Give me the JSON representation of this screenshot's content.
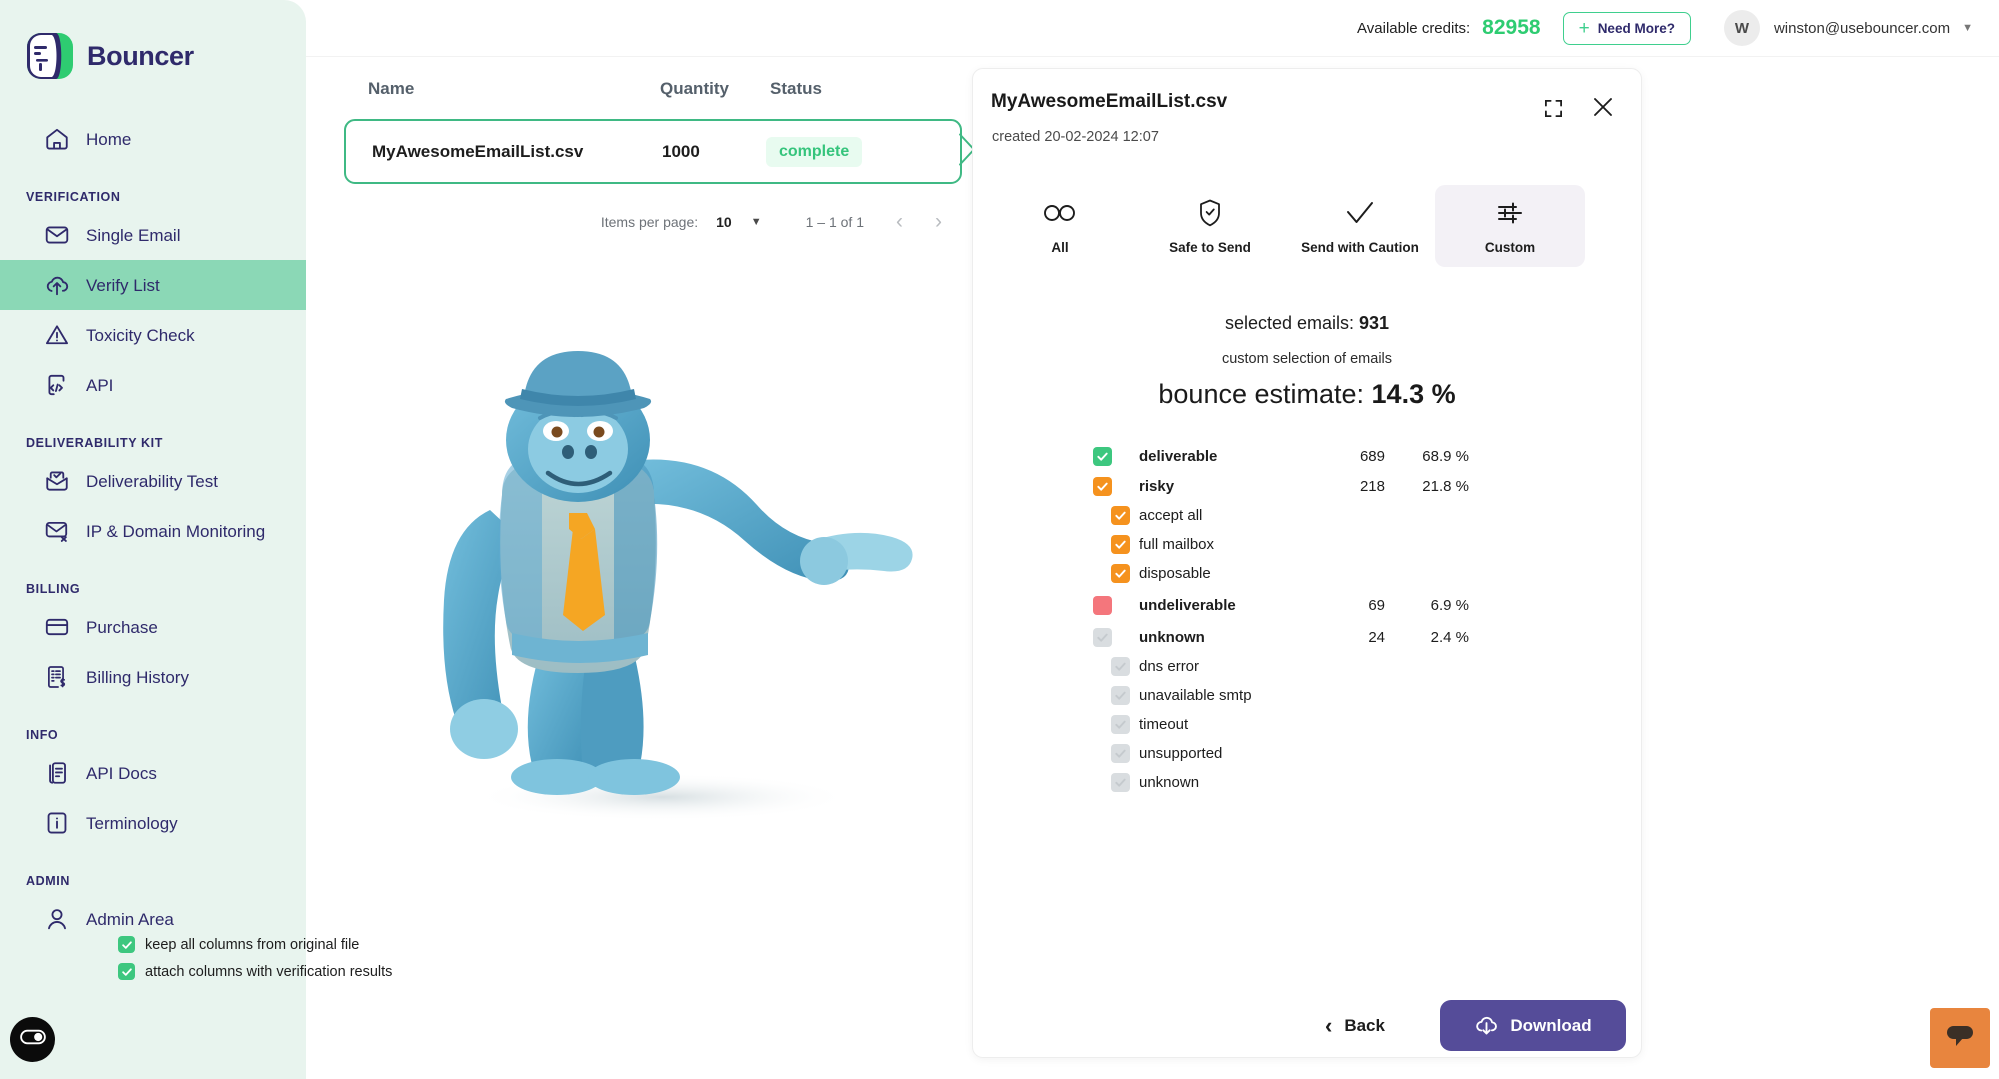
{
  "brand": {
    "name": "Bouncer"
  },
  "sidebar": {
    "home": {
      "label": "Home",
      "icon": "home-icon"
    },
    "sections": [
      {
        "title": "VERIFICATION",
        "items": [
          {
            "label": "Single Email",
            "icon": "envelope-icon",
            "active": false
          },
          {
            "label": "Verify List",
            "icon": "cloud-upload-icon",
            "active": true
          },
          {
            "label": "Toxicity Check",
            "icon": "warning-triangle-icon",
            "active": false
          },
          {
            "label": "API",
            "icon": "code-file-icon",
            "active": false
          }
        ]
      },
      {
        "title": "DELIVERABILITY KIT",
        "items": [
          {
            "label": "Deliverability Test",
            "icon": "envelope-check-icon",
            "active": false
          },
          {
            "label": "IP & Domain Monitoring",
            "icon": "envelope-x-icon",
            "active": false
          }
        ]
      },
      {
        "title": "BILLING",
        "items": [
          {
            "label": "Purchase",
            "icon": "credit-card-icon",
            "active": false
          },
          {
            "label": "Billing History",
            "icon": "invoice-dollar-icon",
            "active": false
          }
        ]
      },
      {
        "title": "INFO",
        "items": [
          {
            "label": "API Docs",
            "icon": "documents-icon",
            "active": false
          },
          {
            "label": "Terminology",
            "icon": "info-icon",
            "active": false
          }
        ]
      },
      {
        "title": "ADMIN",
        "items": [
          {
            "label": "Admin Area",
            "icon": "user-icon",
            "active": false
          }
        ]
      }
    ]
  },
  "topbar": {
    "credits_label": "Available credits:",
    "credits_value": "82958",
    "need_more_label": "Need More?",
    "need_more_plus": "+",
    "avatar_initial": "W",
    "user_email": "winston@usebouncer.com",
    "caret": "▼"
  },
  "table": {
    "columns": {
      "name": "Name",
      "quantity": "Quantity",
      "status": "Status"
    },
    "rows": [
      {
        "name": "MyAwesomeEmailList.csv",
        "quantity": "1000",
        "status": "complete"
      }
    ],
    "pager": {
      "items_per_page_label": "Items per page:",
      "items_per_page_value": "10",
      "caret": "▼",
      "range": "1 – 1 of 1",
      "prev": "‹",
      "next": "›"
    }
  },
  "panel": {
    "title": "MyAwesomeEmailList.csv",
    "created": "created 20-02-2024 12:07",
    "expand_icon": "expand-icon",
    "close_icon": "close-icon",
    "tabs": [
      {
        "label": "All",
        "icon": "infinity-icon",
        "selected": false
      },
      {
        "label": "Safe to Send",
        "icon": "shield-check-icon",
        "selected": false
      },
      {
        "label": "Send with Caution",
        "icon": "check-icon",
        "selected": false
      },
      {
        "label": "Custom",
        "icon": "sliders-icon",
        "selected": true
      }
    ],
    "selected_emails_label": "selected emails:",
    "selected_emails_value": "931",
    "subtitle": "custom selection of emails",
    "bounce_label": "bounce estimate:",
    "bounce_value": "14.3 %",
    "categories": [
      {
        "label": "deliverable",
        "count": "689",
        "pct": "68.9 %",
        "state": "green",
        "level": "major"
      },
      {
        "label": "risky",
        "count": "218",
        "pct": "21.8 %",
        "state": "orange",
        "level": "major"
      },
      {
        "label": "accept all",
        "count": "",
        "pct": "",
        "state": "orange",
        "level": "sub"
      },
      {
        "label": "full mailbox",
        "count": "",
        "pct": "",
        "state": "orange",
        "level": "sub"
      },
      {
        "label": "disposable",
        "count": "",
        "pct": "",
        "state": "orange",
        "level": "sub"
      },
      {
        "label": "undeliverable",
        "count": "69",
        "pct": "6.9 %",
        "state": "red",
        "level": "major"
      },
      {
        "label": "unknown",
        "count": "24",
        "pct": "2.4 %",
        "state": "grey",
        "level": "major"
      },
      {
        "label": "dns error",
        "count": "",
        "pct": "",
        "state": "grey",
        "level": "sub"
      },
      {
        "label": "unavailable smtp",
        "count": "",
        "pct": "",
        "state": "grey",
        "level": "sub"
      },
      {
        "label": "timeout",
        "count": "",
        "pct": "",
        "state": "grey",
        "level": "sub"
      },
      {
        "label": "unsupported",
        "count": "",
        "pct": "",
        "state": "grey",
        "level": "sub"
      },
      {
        "label": "unknown",
        "count": "",
        "pct": "",
        "state": "grey",
        "level": "sub"
      }
    ],
    "options": [
      {
        "label": "keep all columns from original file",
        "checked": true
      },
      {
        "label": "attach columns with verification results",
        "checked": true
      }
    ],
    "back_label": "Back",
    "back_chevron": "‹",
    "download_label": "Download"
  },
  "widgets": {
    "cookie_icon": "cookie-consent-icon",
    "chat_icon": "chat-bubble-icon"
  },
  "colors": {
    "brand_navy": "#2F2A6B",
    "sidebar_bg": "#E8F4EE",
    "active_nav": "#8BD8B6",
    "green": "#3DC77F",
    "credit_green": "#2ECC71",
    "orange": "#F5921E",
    "red": "#F4767C",
    "grey": "#D5D9DC",
    "purple": "#554C99",
    "chat_orange": "#E8853E"
  }
}
